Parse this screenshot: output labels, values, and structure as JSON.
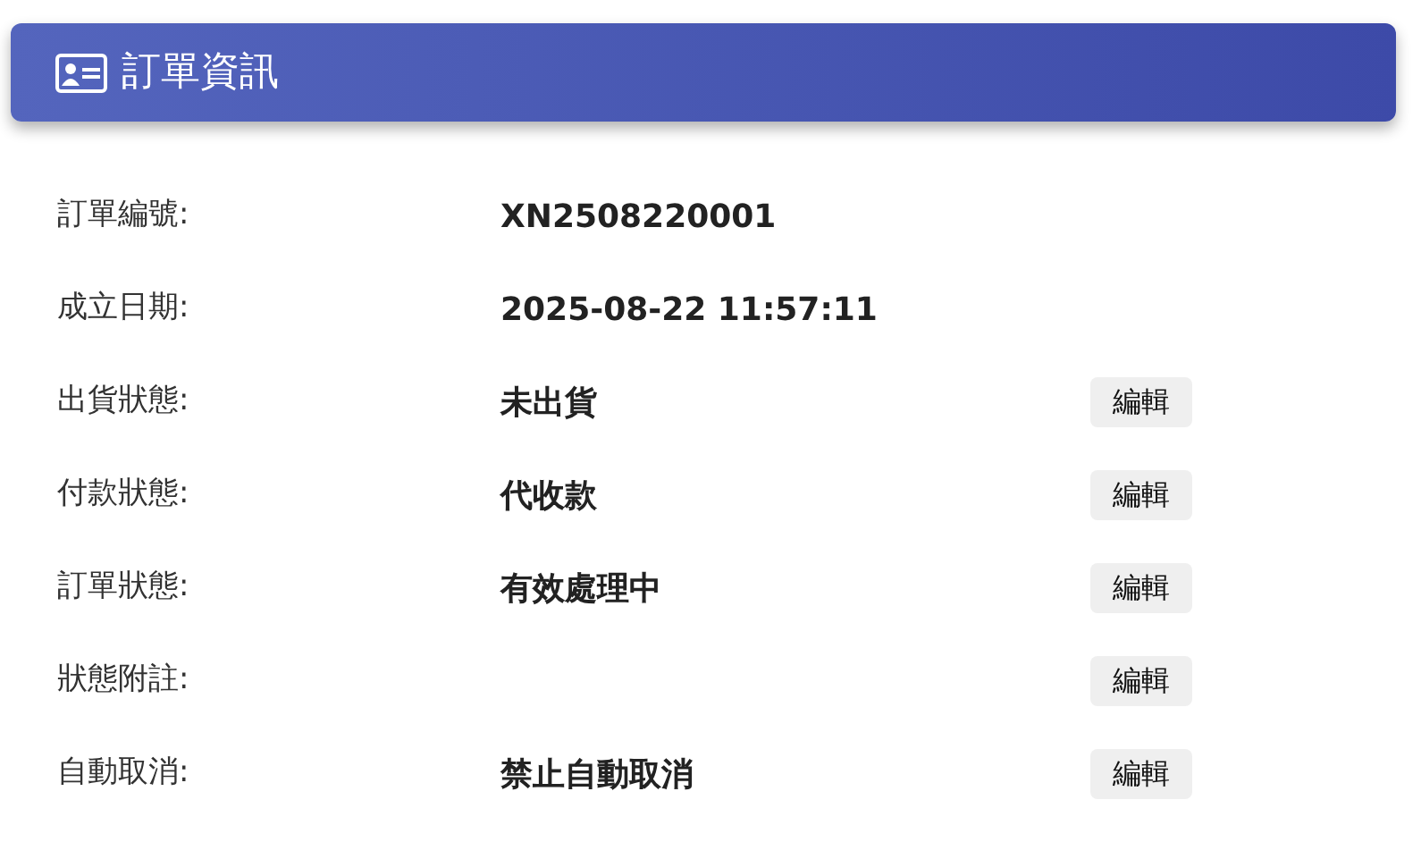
{
  "header": {
    "title": "訂單資訊"
  },
  "rows": [
    {
      "label": "訂單編號:",
      "value": "XN2508220001"
    },
    {
      "label": "成立日期:",
      "value": "2025-08-22 11:57:11"
    },
    {
      "label": "出貨狀態:",
      "value": "未出貨",
      "button": "編輯"
    },
    {
      "label": "付款狀態:",
      "value": "代收款",
      "button": "編輯"
    },
    {
      "label": "訂單狀態:",
      "value": "有效處理中",
      "button": "編輯"
    },
    {
      "label": "狀態附註:",
      "button": "編輯"
    },
    {
      "label": "自動取消:",
      "value": "禁止自動取消",
      "button": "編輯"
    }
  ]
}
